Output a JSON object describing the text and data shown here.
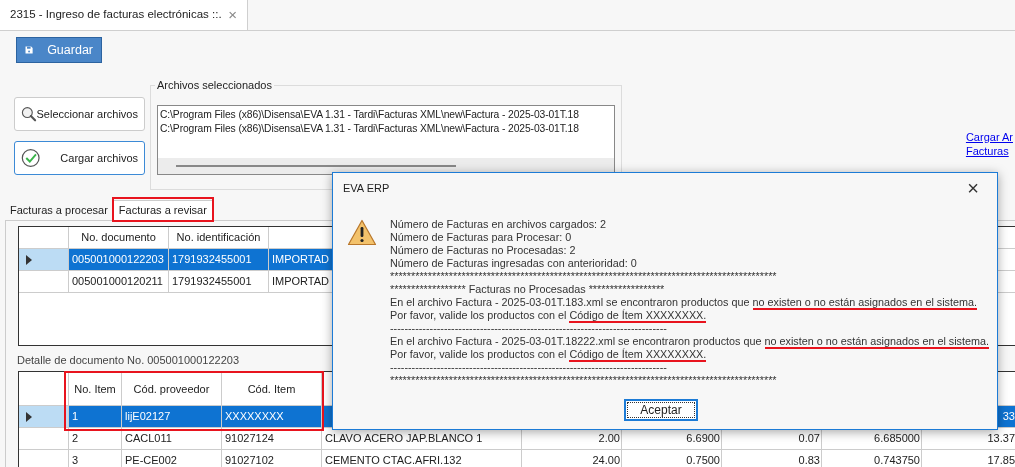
{
  "document_tab": {
    "title": "2315 - Ingreso de facturas electrónicas ::.",
    "close": "×"
  },
  "toolbar": {
    "save_button": "Guardar"
  },
  "actions": [
    {
      "kind": "search",
      "label": "Seleccionar archivos"
    },
    {
      "kind": "load",
      "label": "Cargar archivos"
    }
  ],
  "selected_files": {
    "title": "Archivos seleccionados",
    "lines": [
      "C:\\Program Files (x86)\\Disensa\\EVA 1.31 - Tardi\\Facturas XML\\new\\Factura - 2025-03-01T.18",
      "C:\\Program Files (x86)\\Disensa\\EVA 1.31 - Tardi\\Facturas XML\\new\\Factura - 2025-03-01T.18"
    ]
  },
  "links": [
    "Cargar Ar",
    "Facturas"
  ],
  "tabs": [
    {
      "label": "Facturas a procesar",
      "selected": false,
      "highlighted": false
    },
    {
      "label": "Facturas a revisar",
      "selected": true,
      "highlighted": true
    }
  ],
  "documents_table": {
    "columns": [
      "No. documento",
      "No. identificación"
    ],
    "rows": [
      {
        "selected": true,
        "cells": [
          "005001000122203",
          "1791932455001",
          "IMPORTAD"
        ]
      },
      {
        "selected": false,
        "cells": [
          "005001000120211",
          "1791932455001",
          "IMPORTAD"
        ]
      }
    ]
  },
  "detail_label": "Detalle de documento No. 005001000122203",
  "detail_table": {
    "highlighted": true,
    "columns": [
      "No. Item",
      "Cód. proveedor",
      "Cód. Item"
    ],
    "rows": [
      {
        "selected": true,
        "cells": [
          "1",
          "lijE02127",
          "XXXXXXXX"
        ],
        "total": "33"
      },
      {
        "selected": false,
        "cells": [
          "2",
          "CACL011",
          "91027124",
          "CLAVO ACERO JAP.BLANCO 1",
          "2.00",
          "6.6900",
          "0.07",
          "6.685000"
        ],
        "total": "13.37"
      },
      {
        "selected": false,
        "cells": [
          "3",
          "PE-CE002",
          "91027102",
          "CEMENTO CTAC.AFRI.132",
          "24.00",
          "0.7500",
          "0.83",
          "0.743750"
        ],
        "total": "17.85"
      }
    ]
  },
  "dialog": {
    "title": "EVA ERP",
    "close": "×",
    "button": "Aceptar",
    "lines": [
      {
        "segments": [
          {
            "text": "Número de Facturas en archivos cargados: 2",
            "marked": false
          }
        ]
      },
      {
        "segments": [
          {
            "text": "Número de Facturas para Procesar: 0",
            "marked": false
          }
        ]
      },
      {
        "segments": [
          {
            "text": "Número de Facturas no Procesadas: 2",
            "marked": false
          }
        ]
      },
      {
        "segments": [
          {
            "text": "Número de Facturas ingresadas con anterioridad: 0",
            "marked": false
          }
        ]
      },
      {
        "segments": [
          {
            "text": "********************************************************************************************",
            "marked": false
          }
        ]
      },
      {
        "segments": [
          {
            "text": "****************** Facturas no Procesadas ******************",
            "marked": false
          }
        ]
      },
      {
        "segments": [
          {
            "text": "En el archivo Factura - 2025-03-01T.183.xml se encontraron productos que ",
            "marked": false
          },
          {
            "text": "no existen o no están asignados en el sistema.",
            "marked": true
          }
        ]
      },
      {
        "segments": [
          {
            "text": "Por favor, valide los productos con el ",
            "marked": false
          },
          {
            "text": "Código de Ítem XXXXXXXX.",
            "marked": true
          }
        ]
      },
      {
        "segments": [
          {
            "text": "-----------------------------------------------------------------------------",
            "marked": false
          }
        ]
      },
      {
        "segments": [
          {
            "text": "En el archivo Factura - 2025-03-01T.18222.xml se encontraron productos que ",
            "marked": false
          },
          {
            "text": "no existen o no están asignados en el sistema.",
            "marked": true
          }
        ]
      },
      {
        "segments": [
          {
            "text": "Por favor, valide los productos con el ",
            "marked": false
          },
          {
            "text": "Código de Ítem XXXXXXXX.",
            "marked": true
          }
        ]
      },
      {
        "segments": [
          {
            "text": "-----------------------------------------------------------------------------",
            "marked": false
          }
        ]
      },
      {
        "segments": [
          {
            "text": "********************************************************************************************",
            "marked": false
          }
        ]
      }
    ]
  }
}
